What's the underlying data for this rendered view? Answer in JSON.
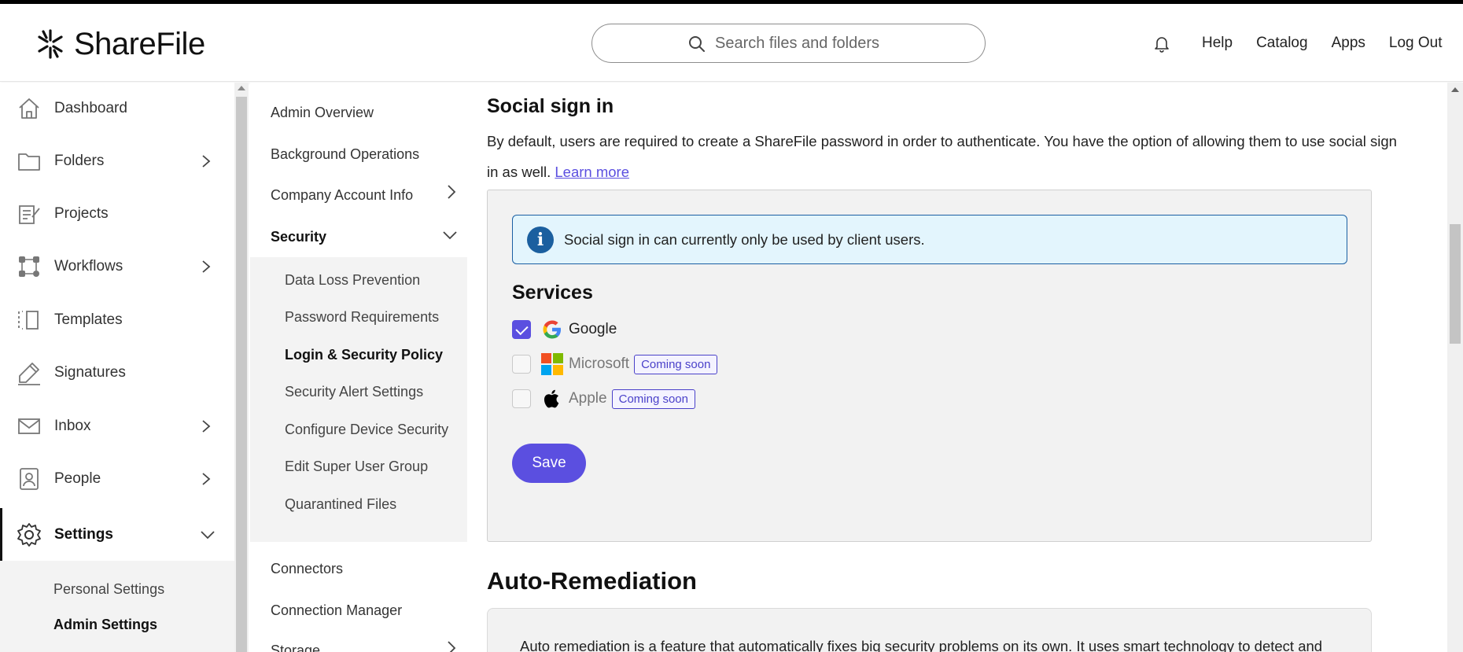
{
  "header": {
    "brand": "ShareFile",
    "search_placeholder": "Search files and folders",
    "links": [
      "Help",
      "Catalog",
      "Apps",
      "Log Out"
    ]
  },
  "sidebar": {
    "items": [
      {
        "label": "Dashboard",
        "icon": "home-icon"
      },
      {
        "label": "Folders",
        "icon": "folder-icon"
      },
      {
        "label": "Projects",
        "icon": "projects-icon"
      },
      {
        "label": "Workflows",
        "icon": "workflows-icon"
      },
      {
        "label": "Templates",
        "icon": "templates-icon"
      },
      {
        "label": "Signatures",
        "icon": "pen-icon"
      },
      {
        "label": "Inbox",
        "icon": "mail-icon"
      },
      {
        "label": "People",
        "icon": "person-icon"
      },
      {
        "label": "Settings",
        "icon": "gear-icon"
      }
    ],
    "settings_sub": [
      "Personal Settings",
      "Admin Settings"
    ]
  },
  "admin_nav": {
    "items": [
      "Admin Overview",
      "Background Operations",
      "Company Account Info",
      "Security",
      "Connectors",
      "Connection Manager",
      "Storage"
    ],
    "security_sub": [
      "Data Loss Prevention",
      "Password Requirements",
      "Login & Security Policy",
      "Security Alert Settings",
      "Configure Device Security",
      "Edit Super User Group",
      "Quarantined Files"
    ]
  },
  "main": {
    "social_title": "Social sign in",
    "social_desc": "By default, users are required to create a ShareFile password in order to authenticate. You have the option of allowing them to use social sign in as well.",
    "learn_more": "Learn more",
    "info_message": "Social sign in can currently only be used by client users.",
    "services_title": "Services",
    "services": [
      {
        "name": "Google",
        "checked": true,
        "badge": ""
      },
      {
        "name": "Microsoft",
        "checked": false,
        "badge": "Coming soon"
      },
      {
        "name": "Apple",
        "checked": false,
        "badge": "Coming soon"
      }
    ],
    "save_label": "Save",
    "auto_title": "Auto-Remediation",
    "auto_desc": "Auto remediation is a feature that automatically fixes big security problems on its own. It uses smart technology to detect and"
  },
  "colors": {
    "accent": "#5b4fe0",
    "info_bg": "#e3f5fd",
    "info_border": "#1a5fa3"
  }
}
